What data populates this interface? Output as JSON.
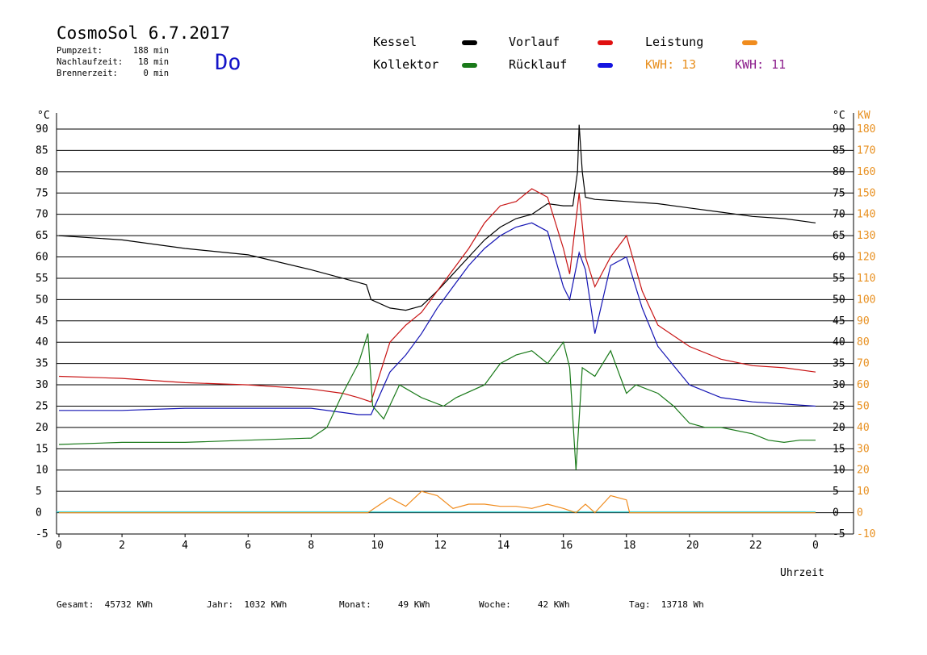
{
  "header": {
    "title": "CosmoSol 6.7.2017",
    "day": "Do",
    "pumpzeit": "Pumpzeit:      188 min",
    "nachlaufzeit": "Nachlaufzeit:   18 min",
    "brennerzeit": "Brennerzeit:     0 min"
  },
  "legend": {
    "kessel": "Kessel",
    "kollektor": "Kollektor",
    "vorlauf": "Vorlauf",
    "ruecklauf": "Rücklauf",
    "leistung": "Leistung",
    "kwh1": "KWH: 13",
    "kwh2": "KWH: 11"
  },
  "colors": {
    "kessel": "#000000",
    "kollektor": "#1a7a1a",
    "vorlauf": "#c81414",
    "ruecklauf": "#1414b4",
    "leistung": "#f08c1e",
    "purple": "#8c1e8c",
    "baseline": "#40d8d8"
  },
  "footer": {
    "gesamt": "Gesamt:  45732 KWh",
    "jahr": "Jahr:  1032 KWh",
    "monat": "Monat:     49 KWh",
    "woche": "Woche:     42 KWh",
    "tag": "Tag:  13718 Wh"
  },
  "chart_data": {
    "type": "line",
    "xlabel": "Uhrzeit",
    "ylabel_left": "°C",
    "ylabel_right_c": "°C",
    "ylabel_right_kw": "KW",
    "xlim": [
      0,
      24
    ],
    "ylim": [
      -5,
      90
    ],
    "y2lim": [
      -10,
      180
    ],
    "grid": true,
    "x_ticks": [
      "0",
      "2",
      "4",
      "6",
      "8",
      "10",
      "12",
      "14",
      "16",
      "18",
      "20",
      "22",
      "0"
    ],
    "y_ticks": [
      "90",
      "85",
      "80",
      "75",
      "70",
      "65",
      "60",
      "55",
      "50",
      "45",
      "40",
      "35",
      "30",
      "25",
      "20",
      "15",
      "10",
      "5",
      "0",
      "-5"
    ],
    "y2_ticks": [
      "180",
      "170",
      "160",
      "150",
      "140",
      "130",
      "120",
      "110",
      "100",
      "90",
      "80",
      "70",
      "60",
      "50",
      "40",
      "30",
      "20",
      "10",
      "0",
      "-10"
    ],
    "series": [
      {
        "key": "kessel",
        "x": [
          0,
          2,
          4,
          6,
          8,
          9.5,
          9.75,
          9.9,
          10.5,
          11,
          11.5,
          12,
          12.5,
          13,
          13.5,
          14,
          14.5,
          15,
          15.5,
          16,
          16.3,
          16.45,
          16.5,
          16.6,
          16.7,
          17,
          18,
          19,
          20,
          21,
          22,
          23,
          24
        ],
        "y": [
          65,
          64,
          62,
          60.5,
          57,
          54,
          53.5,
          50,
          48,
          47.5,
          48.5,
          52,
          56,
          60,
          64,
          67,
          69,
          70,
          72.5,
          72,
          72,
          80,
          91,
          80,
          74,
          73.5,
          73,
          72.5,
          71.5,
          70.5,
          69.5,
          69,
          68
        ]
      },
      {
        "key": "vorlauf",
        "x": [
          0,
          2,
          4,
          6,
          8,
          9,
          9.5,
          9.9,
          10.5,
          11,
          11.5,
          12,
          12.5,
          13,
          13.5,
          14,
          14.5,
          15,
          15.5,
          16,
          16.2,
          16.5,
          16.7,
          17,
          17.5,
          18,
          18.5,
          19,
          20,
          21,
          22,
          23,
          24
        ],
        "y": [
          32,
          31.5,
          30.5,
          30,
          29,
          28,
          27,
          26,
          40,
          44,
          47,
          52,
          57,
          62,
          68,
          72,
          73,
          76,
          74,
          62,
          56,
          75,
          60,
          53,
          60,
          65,
          52,
          44,
          39,
          36,
          34.5,
          34,
          33
        ]
      },
      {
        "key": "ruecklauf",
        "x": [
          0,
          2,
          4,
          6,
          8,
          9,
          9.5,
          9.9,
          10.5,
          11,
          11.5,
          12,
          12.5,
          13,
          13.5,
          14,
          14.5,
          15,
          15.5,
          16,
          16.2,
          16.5,
          16.7,
          17,
          17.5,
          18,
          18.5,
          19,
          20,
          21,
          22,
          23,
          24
        ],
        "y": [
          24,
          24,
          24.5,
          24.5,
          24.5,
          23.5,
          23,
          23,
          33,
          37,
          42,
          48,
          53,
          58,
          62,
          65,
          67,
          68,
          66,
          53,
          50,
          61,
          57,
          42,
          58,
          60,
          48,
          39,
          30,
          27,
          26,
          25.5,
          25
        ]
      },
      {
        "key": "kollektor",
        "x": [
          0,
          2,
          4,
          6,
          8,
          8.5,
          9,
          9.5,
          9.8,
          9.95,
          10.3,
          10.8,
          11.5,
          12.2,
          12.6,
          13.5,
          14,
          14.5,
          15,
          15.5,
          16,
          16.2,
          16.4,
          16.6,
          17,
          17.5,
          17.8,
          18,
          18.3,
          19,
          19.5,
          20,
          20.5,
          21,
          22,
          22.5,
          23,
          23.5,
          24
        ],
        "y": [
          16,
          16.5,
          16.5,
          17,
          17.5,
          20,
          28,
          35,
          42,
          25,
          22,
          30,
          27,
          25,
          27,
          30,
          35,
          37,
          38,
          35,
          40,
          34,
          10,
          34,
          32,
          38,
          32,
          28,
          30,
          28,
          25,
          21,
          20,
          20,
          18.5,
          17,
          16.5,
          17,
          17
        ]
      },
      {
        "key": "leistung",
        "x": [
          0,
          9.8,
          10,
          10.5,
          11,
          11.5,
          12,
          12.5,
          13,
          13.5,
          14,
          14.5,
          15,
          15.5,
          16,
          16.4,
          16.7,
          17,
          17.5,
          18,
          18.1,
          24
        ],
        "y": [
          0,
          0,
          2,
          7,
          3,
          10,
          8,
          2,
          4,
          4,
          3,
          3,
          2,
          4,
          2,
          0,
          4,
          0,
          8,
          6,
          0,
          0
        ]
      }
    ]
  }
}
